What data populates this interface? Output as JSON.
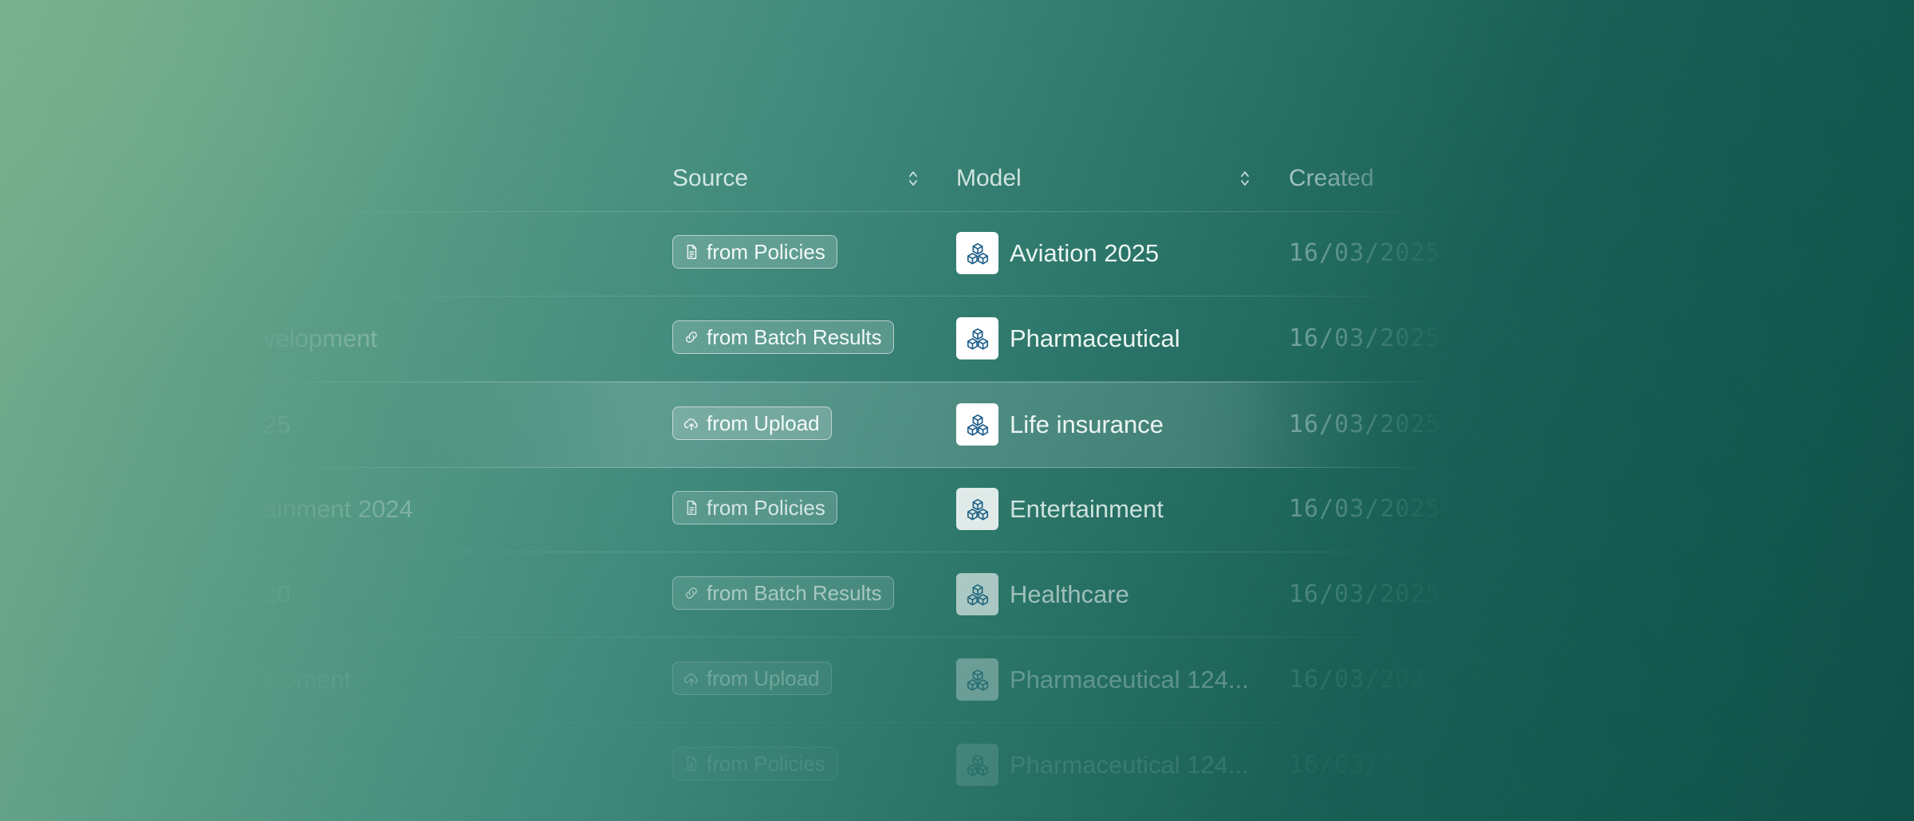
{
  "table": {
    "columns": [
      {
        "label": "Source",
        "sortable": true
      },
      {
        "label": "Model",
        "sortable": true
      },
      {
        "label": "Created",
        "sortable": false
      }
    ],
    "rows": [
      {
        "name": "",
        "source": "from Policies",
        "source_icon": "document-icon",
        "model": "Aviation 2025",
        "created": "16/03/2025",
        "opacity": 1.0
      },
      {
        "name": "velopment",
        "source": "from Batch Results",
        "source_icon": "link-icon",
        "model": "Pharmaceutical",
        "created": "16/03/2025",
        "opacity": 1.0
      },
      {
        "name": "25",
        "source": "from Upload",
        "source_icon": "upload-cloud-icon",
        "model": "Life insurance",
        "created": "16/03/2025",
        "opacity": 1.0,
        "selected": true
      },
      {
        "name": "ainment 2024",
        "source": "from Policies",
        "source_icon": "document-icon",
        "model": "Entertainment",
        "created": "16/03/2025",
        "opacity": 0.85
      },
      {
        "name": "20",
        "source": "from Batch Results",
        "source_icon": "link-icon",
        "model": "Healthcare",
        "created": "16/03/2025",
        "opacity": 0.6
      },
      {
        "name": "lopment",
        "source": "from Upload",
        "source_icon": "upload-cloud-icon",
        "model": "Pharmaceutical 124...",
        "created": "16/03/2025",
        "opacity": 0.3
      },
      {
        "name": "",
        "source": "from Policies",
        "source_icon": "document-icon",
        "model": "Pharmaceutical 124...",
        "created": "16/03/2025",
        "opacity": 0.12
      }
    ]
  },
  "colors": {
    "background_light": "#78b08e",
    "background_dark": "#0d5048",
    "model_icon_fg": "#1e5f8c",
    "model_icon_bg": "#ffffff"
  }
}
